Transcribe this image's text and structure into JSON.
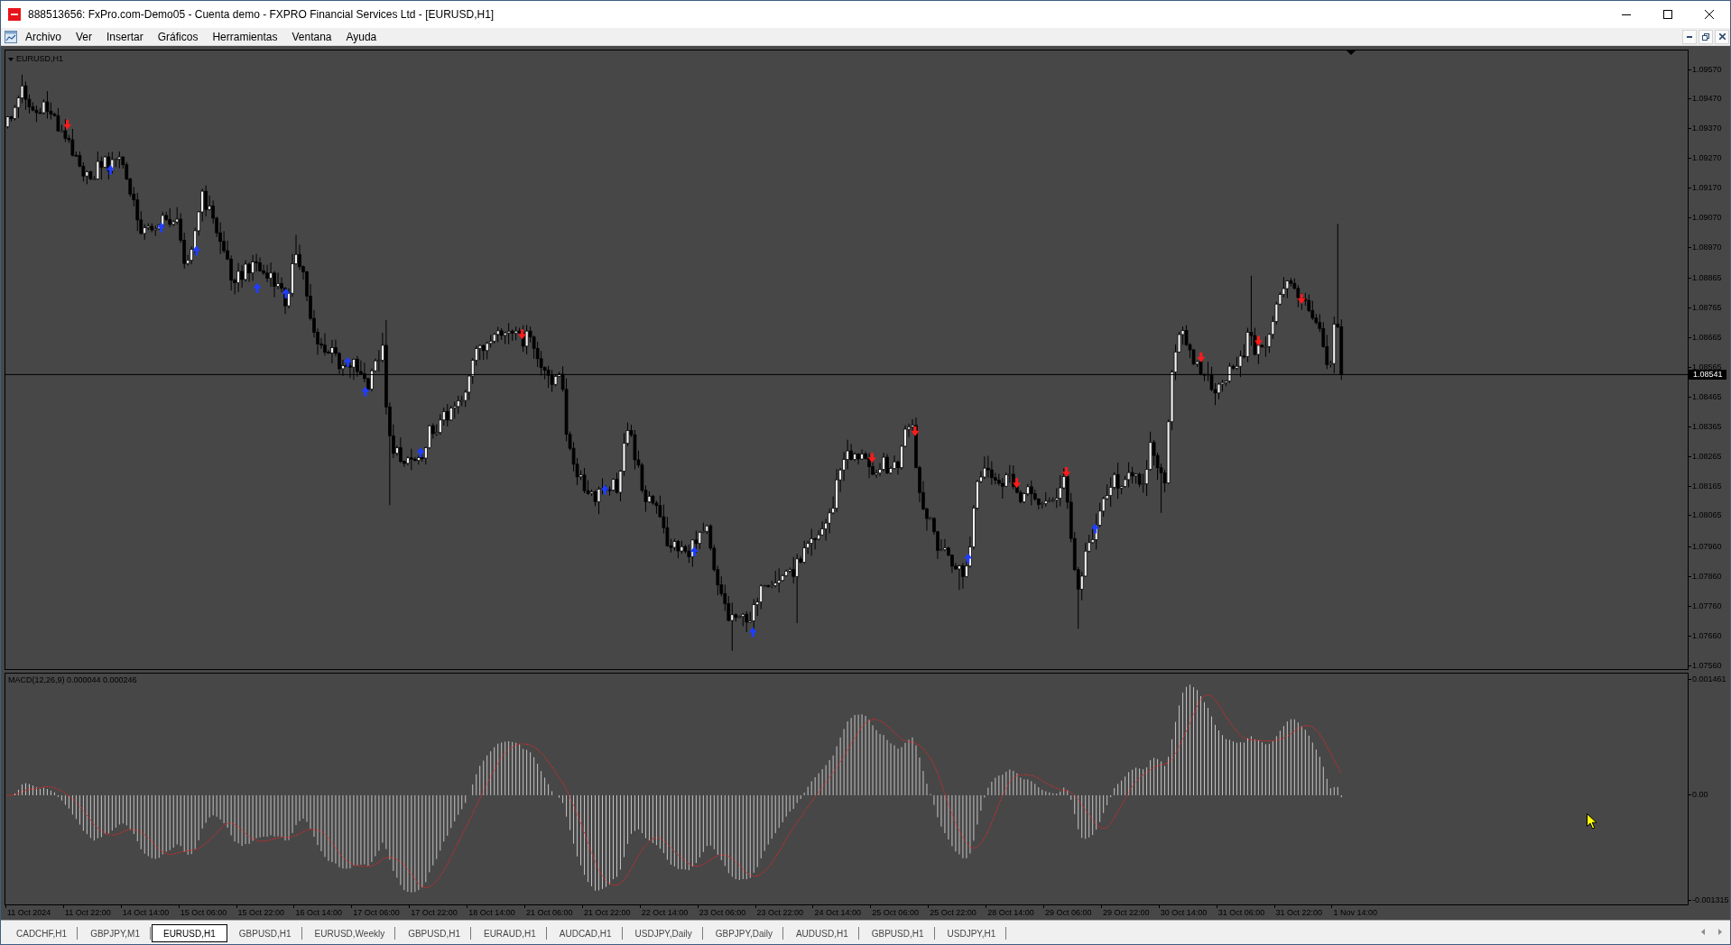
{
  "window": {
    "title": "888513656: FxPro.com-Demo05 - Cuenta demo - FXPRO Financial Services Ltd - [EURUSD,H1]"
  },
  "menu": [
    "Archivo",
    "Ver",
    "Insertar",
    "Gráficos",
    "Herramientas",
    "Ventana",
    "Ayuda"
  ],
  "chart": {
    "symbol": "EURUSD,H1",
    "price_axis": [
      "1.09570",
      "1.09470",
      "1.09370",
      "1.09270",
      "1.09170",
      "1.09070",
      "1.08970",
      "1.08865",
      "1.08765",
      "1.08665",
      "1.08565",
      "1.08465",
      "1.08365",
      "1.08265",
      "1.08165",
      "1.08065",
      "1.07960",
      "1.07860",
      "1.07760",
      "1.07660",
      "1.07560"
    ],
    "current_price": "1.08541",
    "indicator": {
      "label": "MACD(12,26,9) 0.000044 0.000246",
      "axis": [
        "0.001461",
        "0.00",
        "-0.001315"
      ]
    },
    "time_axis": [
      "11 Oct 2024",
      "11 Oct 22:00",
      "14 Oct 14:00",
      "15 Oct 06:00",
      "15 Oct 22:00",
      "16 Oct 14:00",
      "17 Oct 06:00",
      "17 Oct 22:00",
      "18 Oct 14:00",
      "21 Oct 06:00",
      "21 Oct 22:00",
      "22 Oct 14:00",
      "23 Oct 06:00",
      "23 Oct 22:00",
      "24 Oct 14:00",
      "25 Oct 06:00",
      "25 Oct 22:00",
      "28 Oct 14:00",
      "29 Oct 06:00",
      "29 Oct 22:00",
      "30 Oct 14:00",
      "31 Oct 06:00",
      "31 Oct 22:00",
      "1 Nov 14:00"
    ]
  },
  "tabs": [
    {
      "label": "CADCHF,H1",
      "selected": false
    },
    {
      "label": "GBPJPY,M1",
      "selected": false
    },
    {
      "label": "EURUSD,H1",
      "selected": true
    },
    {
      "label": "GBPUSD,H1",
      "selected": false
    },
    {
      "label": "EURUSD,Weekly",
      "selected": false
    },
    {
      "label": "GBPUSD,H1",
      "selected": false
    },
    {
      "label": "EURAUD,H1",
      "selected": false
    },
    {
      "label": "AUDCAD,H1",
      "selected": false
    },
    {
      "label": "USDJPY,Daily",
      "selected": false
    },
    {
      "label": "GBPJPY,Daily",
      "selected": false
    },
    {
      "label": "AUDUSD,H1",
      "selected": false
    },
    {
      "label": "GBPUSD,H1",
      "selected": false
    },
    {
      "label": "USDJPY,H1",
      "selected": false
    }
  ]
}
